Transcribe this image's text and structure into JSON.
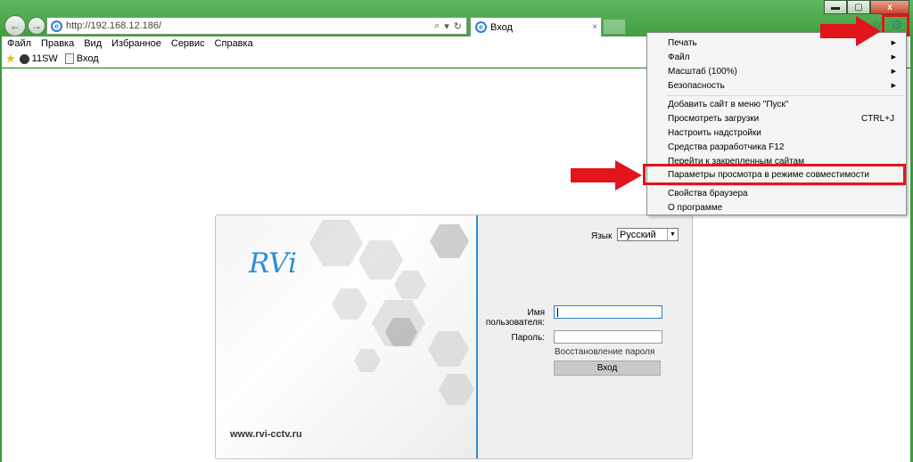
{
  "window": {
    "minimize": "▬",
    "maximize": "▢",
    "close": "x"
  },
  "nav": {
    "back_glyph": "←",
    "forward_glyph": "→",
    "address": "http://192.168.12.186/",
    "search_glyph": "⌕",
    "dropdown_glyph": "▾",
    "refresh_glyph": "↻"
  },
  "tab": {
    "label": "Вход",
    "close_glyph": "×"
  },
  "toolbar_icons": {
    "home": "⌂",
    "favorites": "☆",
    "gear": "⚙"
  },
  "menubar": [
    "Файл",
    "Правка",
    "Вид",
    "Избранное",
    "Сервис",
    "Справка"
  ],
  "favbar": {
    "star_glyph": "★",
    "items": [
      "11SW",
      "Вход"
    ]
  },
  "login": {
    "logo": "RVi",
    "site": "www.rvi-cctv.ru",
    "language_label": "Язык",
    "language_value": "Русский",
    "language_arrow": "▼",
    "username_label": "Имя пользователя:",
    "password_label": "Пароль:",
    "restore_password": "Восстановление пароля",
    "login_button": "Вход"
  },
  "dropdown": {
    "items": [
      {
        "label": "Печать",
        "shortcut": "",
        "arrow": "▶"
      },
      {
        "label": "Файл",
        "shortcut": "",
        "arrow": "▶"
      },
      {
        "label": "Масштаб (100%)",
        "shortcut": "",
        "arrow": "▶"
      },
      {
        "label": "Безопасность",
        "shortcut": "",
        "arrow": "▶"
      },
      {
        "label": "Добавить сайт в меню \"Пуск\"",
        "shortcut": "",
        "arrow": ""
      },
      {
        "label": "Просмотреть загрузки",
        "shortcut": "CTRL+J",
        "arrow": ""
      },
      {
        "label": "Настроить надстройки",
        "shortcut": "",
        "arrow": ""
      },
      {
        "label": "Средства разработчика F12",
        "shortcut": "",
        "arrow": ""
      },
      {
        "label": "Перейти к закрепленным сайтам",
        "shortcut": "",
        "arrow": ""
      },
      {
        "label": "Параметры просмотра в режиме совместимости",
        "shortcut": "",
        "arrow": ""
      },
      {
        "label": "Свойства браузера",
        "shortcut": "",
        "arrow": ""
      },
      {
        "label": "О программе",
        "shortcut": "",
        "arrow": ""
      }
    ]
  },
  "colors": {
    "annotation_red": "#e2141c",
    "accent_blue": "#2a8fd0",
    "window_green": "#3f9e3f"
  }
}
